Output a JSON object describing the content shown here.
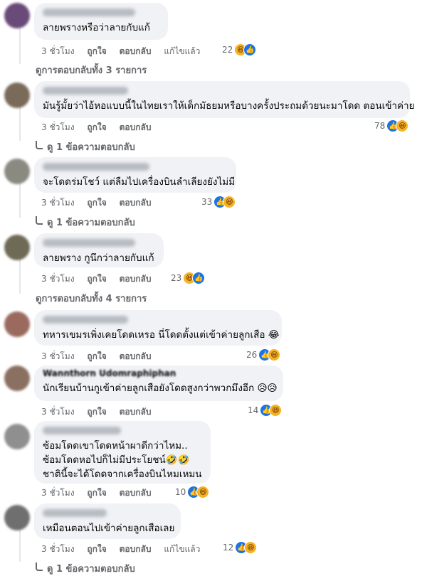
{
  "reaction_icons": {
    "haha": "haha-icon",
    "like": "like-icon"
  },
  "comments": [
    {
      "lines": [
        "ลายพรางหรือว่าลายกับแก้"
      ],
      "author": "",
      "time": "3 ชั่วโมง",
      "like": "ถูกใจ",
      "reply": "ตอบกลับ",
      "edited": "แก้ไขแล้ว",
      "count": "22",
      "replies": "ดูการตอบกลับทั้ง 3 รายการ"
    },
    {
      "lines": [
        "มันรู้มั้ยว่าไอ้หอแบบนี้ในไทยเราให้เด็กมัธยมหรือบางครั้งประถมด้วยนะมาโดด ตอนเข้าค่าย"
      ],
      "author": "",
      "time": "3 ชั่วโมง",
      "like": "ถูกใจ",
      "reply": "ตอบกลับ",
      "edited": "",
      "count": "78",
      "replies": "ดู 1 ข้อความตอบกลับ"
    },
    {
      "lines": [
        "จะโดดร่มโชว์ แต่ลืมไปเครื่องบินลำเลียงยังไม่มี"
      ],
      "author": "",
      "time": "3 ชั่วโมง",
      "like": "ถูกใจ",
      "reply": "ตอบกลับ",
      "edited": "",
      "count": "33",
      "replies": "ดู 1 ข้อความตอบกลับ"
    },
    {
      "lines": [
        "ลายพราง กูนึกว่าลายกับแก้"
      ],
      "author": "",
      "time": "3 ชั่วโมง",
      "like": "ถูกใจ",
      "reply": "ตอบกลับ",
      "edited": "",
      "count": "23",
      "replies": "ดูการตอบกลับทั้ง 4 รายการ"
    },
    {
      "lines": [
        "ทหารเขมรเพิ่งเคยโดดเหรอ นี่โดดตั้งแต่เข้าค่ายลูกเสือ 😂"
      ],
      "author": "",
      "time": "3 ชั่วโมง",
      "like": "ถูกใจ",
      "reply": "ตอบกลับ",
      "edited": "",
      "count": "26",
      "replies": ""
    },
    {
      "lines": [
        "นักเรียนบ้านกูเข้าค่ายลูกเสือยังโดดสูงกว่าพวกมึงอีก 😥😥"
      ],
      "author": "Wannthorn Udomraphiphan",
      "time": "3 ชั่วโมง",
      "like": "ถูกใจ",
      "reply": "ตอบกลับ",
      "edited": "",
      "count": "14",
      "replies": ""
    },
    {
      "lines": [
        "ซ้อมโดดเขาโดดหน้าผาดีกว่าไหม..",
        "ซ้อมโดดหอไปก็ไม่มีประโยชน์🤣🤣",
        "ชาตินี้จะได้โดดจากเครื่องบินไหมเหมน"
      ],
      "author": "",
      "time": "3 ชั่วโมง",
      "like": "ถูกใจ",
      "reply": "ตอบกลับ",
      "edited": "",
      "count": "10",
      "replies": ""
    },
    {
      "lines": [
        "เหมือนตอนไปเข้าค่ายลูกเสือเลย"
      ],
      "author": "",
      "time": "3 ชั่วโมง",
      "like": "ถูกใจ",
      "reply": "ตอบกลับ",
      "edited": "แก้ไขแล้ว",
      "count": "12",
      "replies": "ดู 1 ข้อความตอบกลับ"
    }
  ]
}
